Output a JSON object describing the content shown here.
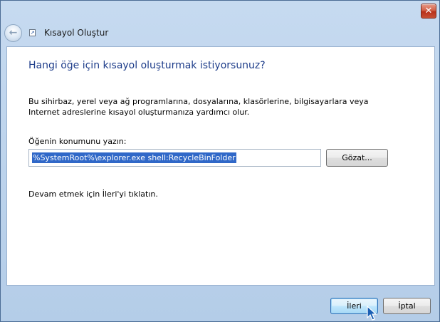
{
  "window": {
    "title": "Kısayol Oluştur",
    "close_glyph": "✕"
  },
  "nav": {
    "back_glyph": "←",
    "shortcut_glyph": "↗"
  },
  "content": {
    "heading": "Hangi öğe için kısayol oluşturmak istiyorsunuz?",
    "description": "Bu sihirbaz, yerel veya ağ programlarına, dosyalarına, klasörlerine, bilgisayarlara veya Internet adreslerine kısayol oluşturmanıza yardımcı olur.",
    "field_label": "Öğenin konumunu yazın:",
    "location_value": "%SystemRoot%\\explorer.exe shell:RecycleBinFolder",
    "browse_label": "Gözat...",
    "hint": "Devam etmek için İleri'yi tıklatın."
  },
  "footer": {
    "next_label": "İleri",
    "cancel_label": "İptal"
  },
  "colors": {
    "heading": "#1e3d8a",
    "selection": "#3068c8",
    "frame": "#c6daf0"
  }
}
